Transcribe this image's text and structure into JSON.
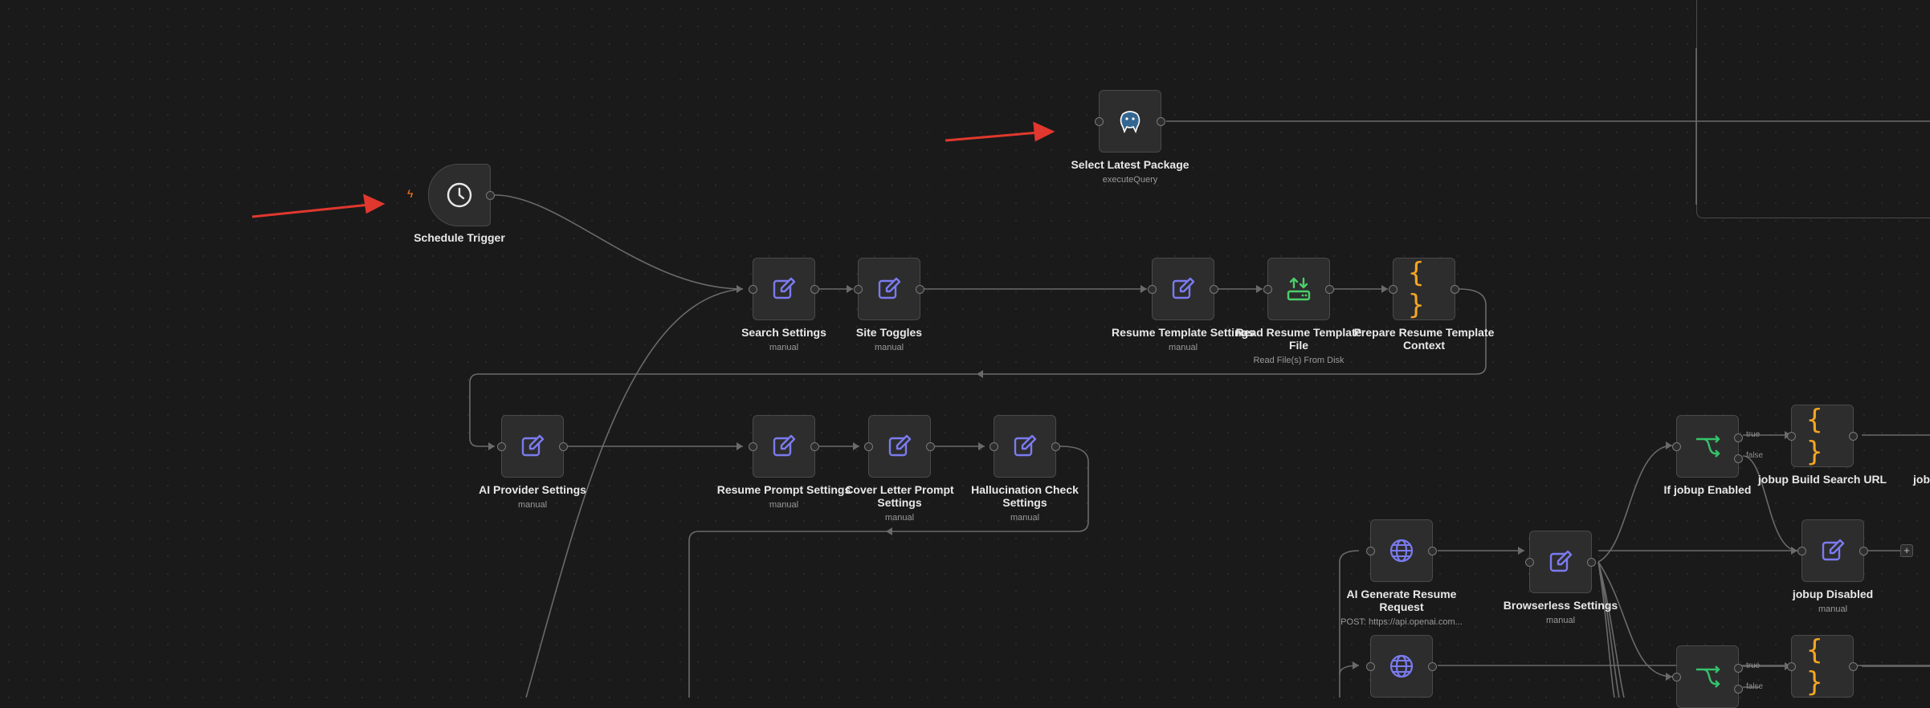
{
  "nodes": {
    "schedule_trigger": {
      "title": "Schedule Trigger",
      "subtitle": ""
    },
    "select_latest_package": {
      "title": "Select Latest Package",
      "subtitle": "executeQuery"
    },
    "search_settings": {
      "title": "Search Settings",
      "subtitle": "manual"
    },
    "site_toggles": {
      "title": "Site Toggles",
      "subtitle": "manual"
    },
    "resume_template_settings": {
      "title": "Resume Template Settings",
      "subtitle": "manual"
    },
    "read_resume_template_file": {
      "title": "Read Resume Template File",
      "subtitle": "Read File(s) From Disk"
    },
    "prepare_resume_template_context": {
      "title": "Prepare Resume Template Context",
      "subtitle": ""
    },
    "ai_provider_settings": {
      "title": "AI Provider Settings",
      "subtitle": "manual"
    },
    "resume_prompt_settings": {
      "title": "Resume Prompt Settings",
      "subtitle": "manual"
    },
    "cover_letter_prompt_settings": {
      "title": "Cover Letter Prompt Settings",
      "subtitle": "manual"
    },
    "hallucination_check_settings": {
      "title": "Hallucination Check Settings",
      "subtitle": "manual"
    },
    "ai_generate_resume_request": {
      "title": "AI Generate Resume Request",
      "subtitle": "POST: https://api.openai.com..."
    },
    "browserless_settings": {
      "title": "Browserless Settings",
      "subtitle": "manual"
    },
    "if_jobup_enabled": {
      "title": "If jobup Enabled",
      "subtitle": ""
    },
    "jobup_build_search_url": {
      "title": "jobup Build Search URL",
      "subtitle": ""
    },
    "jobup_disabled": {
      "title": "jobup Disabled",
      "subtitle": "manual"
    },
    "cut_label_right": {
      "title": "job",
      "subtitle": ""
    }
  },
  "branches": {
    "true_label": "true",
    "false_label": "false"
  },
  "icons": {
    "trigger": "clock-icon",
    "database": "postgres-elephant-icon",
    "set": "pencil-edit-icon",
    "file": "read-file-icon",
    "code": "code-braces-icon",
    "http": "globe-icon",
    "if": "branch-split-icon"
  },
  "colors": {
    "canvas_bg": "#1a1a1a",
    "node_bg": "#2d2d2d",
    "node_border": "#4a4a4a",
    "set_icon": "#7b7bf0",
    "code_icon": "#f5a623",
    "file_icon": "#4ccf6a",
    "if_icon": "#35c26b",
    "wire": "#6a6a6a",
    "annotation_arrow": "#e0382e",
    "trigger_bolt": "#ff7a1a"
  },
  "plus_symbol": "+"
}
